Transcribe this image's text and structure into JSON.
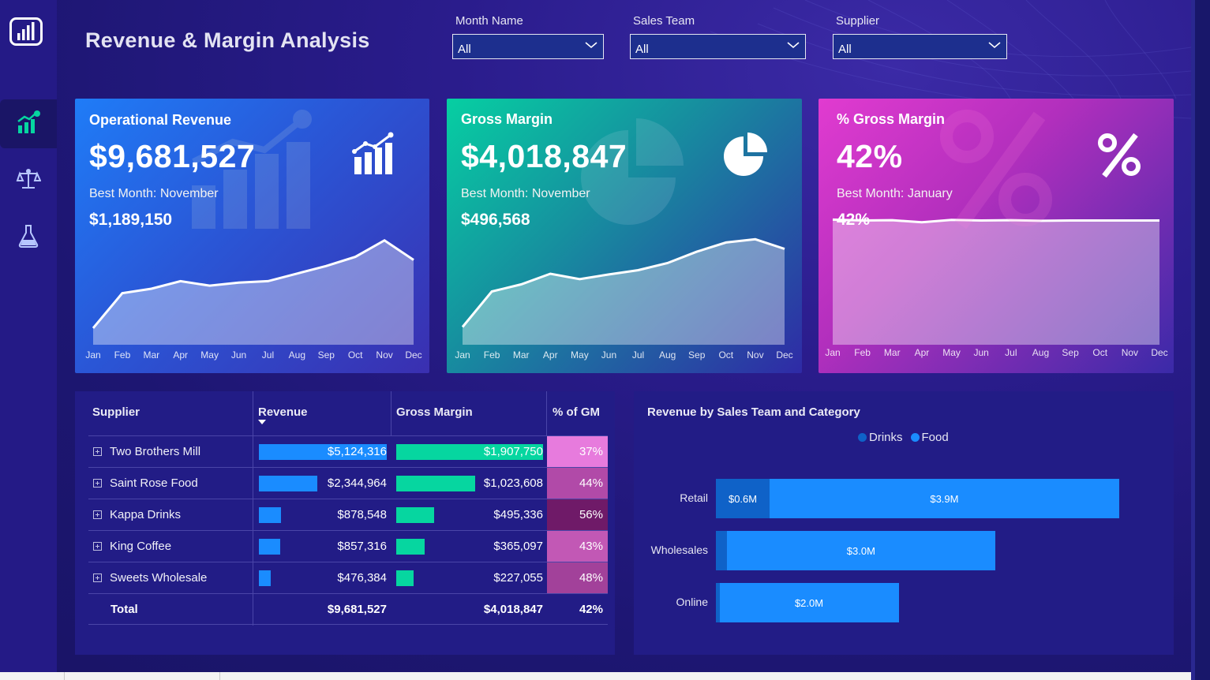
{
  "title": "Revenue & Margin Analysis",
  "filters": [
    {
      "label": "Month Name",
      "value": "All"
    },
    {
      "label": "Sales Team",
      "value": "All"
    },
    {
      "label": "Supplier",
      "value": "All"
    }
  ],
  "sidebar": {
    "logo_icon": "bar-chart-logo-icon",
    "items": [
      {
        "icon": "growth-chart-icon",
        "active": true
      },
      {
        "icon": "balance-scale-icon",
        "active": false
      },
      {
        "icon": "flask-icon",
        "active": false
      }
    ]
  },
  "months": [
    "Jan",
    "Feb",
    "Mar",
    "Apr",
    "May",
    "Jun",
    "Jul",
    "Aug",
    "Sep",
    "Oct",
    "Nov",
    "Dec"
  ],
  "cards": [
    {
      "title": "Operational Revenue",
      "value": "$9,681,527",
      "best_month": "Best Month: November",
      "best_value": "$1,189,150",
      "icon": "bar-growth-icon",
      "colors": [
        "#1f7cf7",
        "#3a2fb0"
      ],
      "series": [
        610,
        840,
        870,
        920,
        890,
        910,
        920,
        970,
        1020,
        1080,
        1189,
        1060
      ]
    },
    {
      "title": "Gross Margin",
      "value": "$4,018,847",
      "best_month": "Best Month: November",
      "best_value": "$496,568",
      "icon": "pie-chart-icon",
      "colors": [
        "#06cfa2",
        "#2f2aa6"
      ],
      "series": [
        250,
        350,
        370,
        400,
        385,
        398,
        410,
        430,
        462,
        488,
        497,
        470
      ]
    },
    {
      "title": "% Gross Margin",
      "value": "42%",
      "best_month": "Best Month: January",
      "best_value": "42%",
      "icon": "percent-icon",
      "colors": [
        "#e13bd0",
        "#3a2aa8"
      ],
      "series": [
        0.421,
        0.418,
        0.419,
        0.412,
        0.42,
        0.418,
        0.419,
        0.417,
        0.418,
        0.418,
        0.418,
        0.418
      ]
    }
  ],
  "table": {
    "headers": {
      "supplier": "Supplier",
      "revenue": "Revenue",
      "gross_margin": "Gross Margin",
      "pct_gm": "% of GM"
    },
    "rows": [
      {
        "supplier": "Two Brothers Mill",
        "revenue": "$5,124,316",
        "revenue_value": 5124316,
        "gross_margin": "$1,907,750",
        "gm_value": 1907750,
        "pct": "37%",
        "pct_color": "#e77bdd"
      },
      {
        "supplier": "Saint Rose Food",
        "revenue": "$2,344,964",
        "revenue_value": 2344964,
        "gross_margin": "$1,023,608",
        "gm_value": 1023608,
        "pct": "44%",
        "pct_color": "#b14aa8"
      },
      {
        "supplier": "Kappa Drinks",
        "revenue": "$878,548",
        "revenue_value": 878548,
        "gross_margin": "$495,336",
        "gm_value": 495336,
        "pct": "56%",
        "pct_color": "#6f1a68"
      },
      {
        "supplier": "King Coffee",
        "revenue": "$857,316",
        "revenue_value": 857316,
        "gross_margin": "$365,097",
        "gm_value": 365097,
        "pct": "43%",
        "pct_color": "#c258b5"
      },
      {
        "supplier": "Sweets Wholesale",
        "revenue": "$476,384",
        "revenue_value": 476384,
        "gross_margin": "$227,055",
        "gm_value": 227055,
        "pct": "48%",
        "pct_color": "#a2419a"
      }
    ],
    "total": {
      "label": "Total",
      "revenue": "$9,681,527",
      "gross_margin": "$4,018,847",
      "pct": "42%"
    }
  },
  "chart_data": {
    "type": "bar",
    "title": "Revenue by Sales Team and Category",
    "orientation": "horizontal",
    "stacked": true,
    "categories": [
      "Retail",
      "Wholesales",
      "Online"
    ],
    "series": [
      {
        "name": "Drinks",
        "values": [
          0.6,
          0.12,
          0.04
        ],
        "labels": [
          "$0.6M",
          "",
          ""
        ],
        "color": "#0f62c8"
      },
      {
        "name": "Food",
        "values": [
          3.9,
          3.0,
          2.0
        ],
        "labels": [
          "$3.9M",
          "$3.0M",
          "$2.0M"
        ],
        "color": "#1a8cff"
      }
    ],
    "legend_position": "top-center",
    "unit": "$M"
  }
}
